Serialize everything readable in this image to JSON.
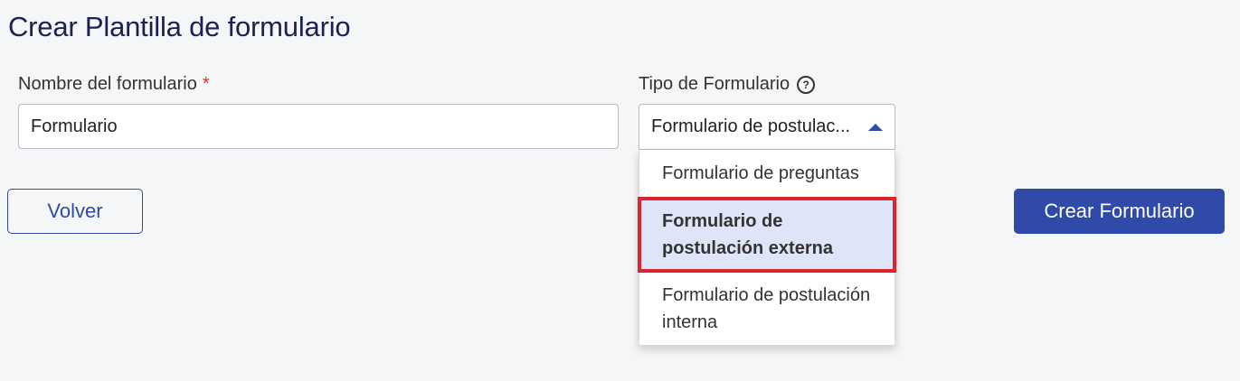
{
  "page": {
    "title": "Crear Plantilla de formulario"
  },
  "form_name": {
    "label": "Nombre del formulario",
    "required_mark": "*",
    "value": "Formulario"
  },
  "form_type": {
    "label": "Tipo de Formulario",
    "help_icon": "question-circle-icon",
    "help_glyph": "?",
    "selected_value": "Formulario de postulac...",
    "options": [
      {
        "label": "Formulario de preguntas"
      },
      {
        "label": "Formulario de postulación externa",
        "highlighted": true
      },
      {
        "label": "Formulario de postulación interna"
      }
    ]
  },
  "actions": {
    "back_label": "Volver",
    "create_label": "Crear Formulario"
  },
  "colors": {
    "primary": "#2f4aa8",
    "title": "#1b2150",
    "required": "#d0342c",
    "highlight_border": "#d7262e",
    "highlight_bg": "#dfe5f8"
  }
}
